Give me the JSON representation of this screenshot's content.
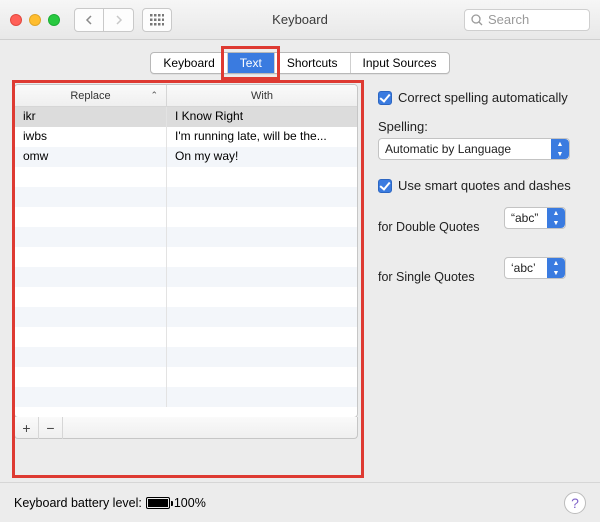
{
  "window": {
    "title": "Keyboard"
  },
  "search": {
    "placeholder": "Search"
  },
  "tabs": {
    "items": [
      "Keyboard",
      "Text",
      "Shortcuts",
      "Input Sources"
    ],
    "active_index": 1
  },
  "table": {
    "columns": {
      "replace": "Replace",
      "withcol": "With"
    },
    "sort_col_index": 0,
    "rows": [
      {
        "replace": "ikr",
        "with": "I Know Right",
        "selected": true
      },
      {
        "replace": "iwbs",
        "with": "I'm running late, will be the...",
        "selected": false
      },
      {
        "replace": "omw",
        "with": "On my way!",
        "selected": false
      }
    ]
  },
  "opts": {
    "correct_spelling_label": "Correct spelling automatically",
    "correct_spelling_checked": true,
    "spelling_label": "Spelling:",
    "spelling_value": "Automatic by Language",
    "smart_quotes_label": "Use smart quotes and dashes",
    "smart_quotes_checked": true,
    "double_label": "for Double Quotes",
    "double_value": "“abc”",
    "single_label": "for Single Quotes",
    "single_value": "‘abc’"
  },
  "footer": {
    "battery_label": "Keyboard battery level:",
    "battery_pct": "100%"
  },
  "icons": {
    "add": "+",
    "remove": "−"
  }
}
